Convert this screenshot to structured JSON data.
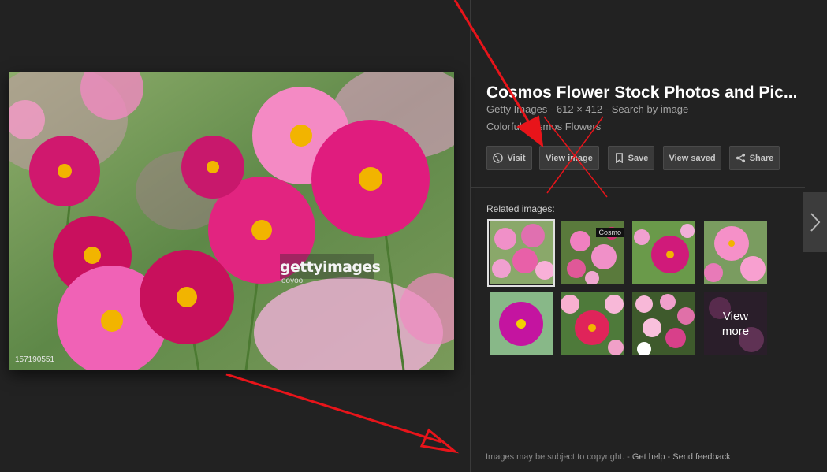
{
  "preview": {
    "watermark_brand": "gettyimages",
    "watermark_credit": "ooyoo",
    "photo_id": "157190551"
  },
  "details": {
    "title": "Cosmos Flower Stock Photos and Pic...",
    "source": "Getty Images",
    "dimensions": "612 × 412",
    "search_by_image": "Search by image",
    "caption": "Colorful Cosmos Flowers",
    "separator": "-"
  },
  "actions": {
    "visit": "Visit",
    "view_image": "View image",
    "save": "Save",
    "view_saved": "View saved",
    "share": "Share"
  },
  "related": {
    "label": "Related images:",
    "thumb_tag": "Cosmo",
    "view_more": "View more"
  },
  "footer": {
    "copyright": "Images may be subject to copyright.",
    "get_help": "Get help",
    "send_feedback": "Send feedback",
    "separator": "-"
  },
  "colors": {
    "background": "#222222",
    "button_bg": "#3a3a3a",
    "annotation_arrow": "#e8141a",
    "flower_magenta": "#d81b7a",
    "flower_pink": "#f080c0"
  },
  "icons": {
    "visit": "globe-icon",
    "save": "bookmark-icon",
    "share": "share-icon",
    "next": "chevron-right-icon"
  }
}
